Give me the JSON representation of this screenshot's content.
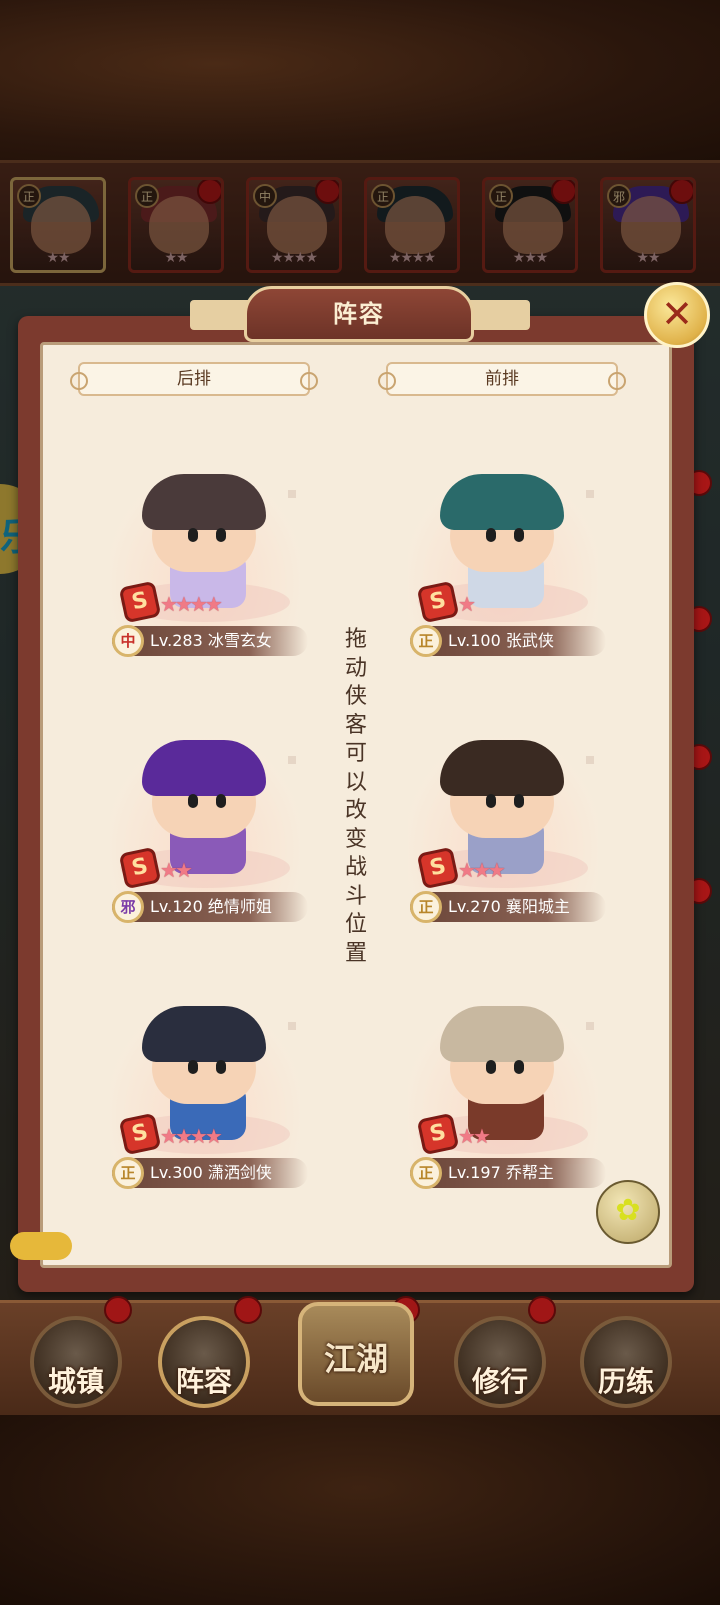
{
  "top_strip": {
    "heroes": [
      {
        "faction": "正",
        "stars": "★★",
        "selected": true
      },
      {
        "faction": "正",
        "stars": "★★",
        "selected": false
      },
      {
        "faction": "中",
        "stars": "★★★★",
        "selected": false
      },
      {
        "faction": "正",
        "stars": "★★★★",
        "selected": false
      },
      {
        "faction": "正",
        "stars": "★★★",
        "selected": false
      },
      {
        "faction": "邪",
        "stars": "★★",
        "selected": false
      }
    ]
  },
  "panel": {
    "title": "阵容",
    "close_icon": "✕",
    "back_row_label": "后排",
    "front_row_label": "前排",
    "drag_hint": "拖动侠客可以改变战斗位置"
  },
  "formation": {
    "back": [
      {
        "rank": "S",
        "stars_on": 4,
        "stars_total": 4,
        "faction": "中",
        "faction_color": "#c8302a",
        "level": "Lv.283",
        "name": "冰雪玄女",
        "hair": "#4a3a3a",
        "outfit": "#c9b8e8"
      },
      {
        "rank": "S",
        "stars_on": 2,
        "stars_total": 2,
        "faction": "邪",
        "faction_color": "#7a3aa8",
        "level": "Lv.120",
        "name": "绝情师姐",
        "hair": "#5a2a9a",
        "outfit": "#8a5ab8"
      },
      {
        "rank": "S",
        "stars_on": 4,
        "stars_total": 4,
        "faction": "正",
        "faction_color": "#b8862a",
        "level": "Lv.300",
        "name": "潇洒剑侠",
        "hair": "#2a2e3e",
        "outfit": "#3a6ab8"
      }
    ],
    "front": [
      {
        "rank": "S",
        "stars_on": 1,
        "stars_total": 1,
        "faction": "正",
        "faction_color": "#b8862a",
        "level": "Lv.100",
        "name": "张武侠",
        "hair": "#2a6a6a",
        "outfit": "#cfd8e6"
      },
      {
        "rank": "S",
        "stars_on": 3,
        "stars_total": 3,
        "faction": "正",
        "faction_color": "#b8862a",
        "level": "Lv.270",
        "name": "襄阳城主",
        "hair": "#3a2a22",
        "outfit": "#9aa0c8"
      },
      {
        "rank": "S",
        "stars_on": 2,
        "stars_total": 2,
        "faction": "正",
        "faction_color": "#b8862a",
        "level": "Lv.197",
        "name": "乔帮主",
        "hair": "#c8b8a0",
        "outfit": "#7a3a2a"
      }
    ]
  },
  "bottom_nav": {
    "items": [
      {
        "label": "城镇"
      },
      {
        "label": "阵容"
      },
      {
        "label": "江湖"
      },
      {
        "label": "修行"
      },
      {
        "label": "历练"
      }
    ],
    "active": "阵容"
  },
  "side_tab": "乐"
}
